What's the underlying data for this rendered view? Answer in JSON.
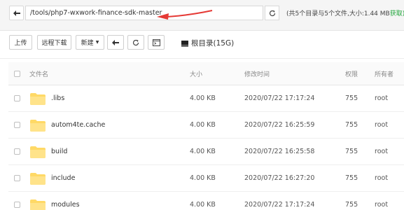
{
  "address_bar": {
    "path": "/tools/php7-wxwork-finance-sdk-master",
    "summary": "(共5个目录与5个文件,大小:1.44 MB",
    "fetch_label": "获取)"
  },
  "toolbar": {
    "upload": "上传",
    "remote_download": "远程下载",
    "new": "新建",
    "disk_label": "根目录(15G)"
  },
  "table": {
    "headers": {
      "name": "文件名",
      "size": "大小",
      "modified": "修改时间",
      "permission": "权限",
      "owner": "所有者"
    },
    "rows": [
      {
        "name": ".libs",
        "size": "4.00 KB",
        "modified": "2020/07/22 17:17:24",
        "permission": "755",
        "owner": "root"
      },
      {
        "name": "autom4te.cache",
        "size": "4.00 KB",
        "modified": "2020/07/22 16:25:59",
        "permission": "755",
        "owner": "root"
      },
      {
        "name": "build",
        "size": "4.00 KB",
        "modified": "2020/07/22 16:25:58",
        "permission": "755",
        "owner": "root"
      },
      {
        "name": "include",
        "size": "4.00 KB",
        "modified": "2020/07/22 16:27:20",
        "permission": "755",
        "owner": "root"
      },
      {
        "name": "modules",
        "size": "4.00 KB",
        "modified": "2020/07/22 17:17:24",
        "permission": "755",
        "owner": "root"
      }
    ]
  },
  "colors": {
    "folder": "#ffd966",
    "annotation": "#e53935",
    "accent_green": "#20a53a"
  },
  "icons": [
    "arrow-left-icon",
    "refresh-icon",
    "terminal-icon",
    "hard-disk-icon",
    "folder-icon",
    "caret-down-icon"
  ]
}
